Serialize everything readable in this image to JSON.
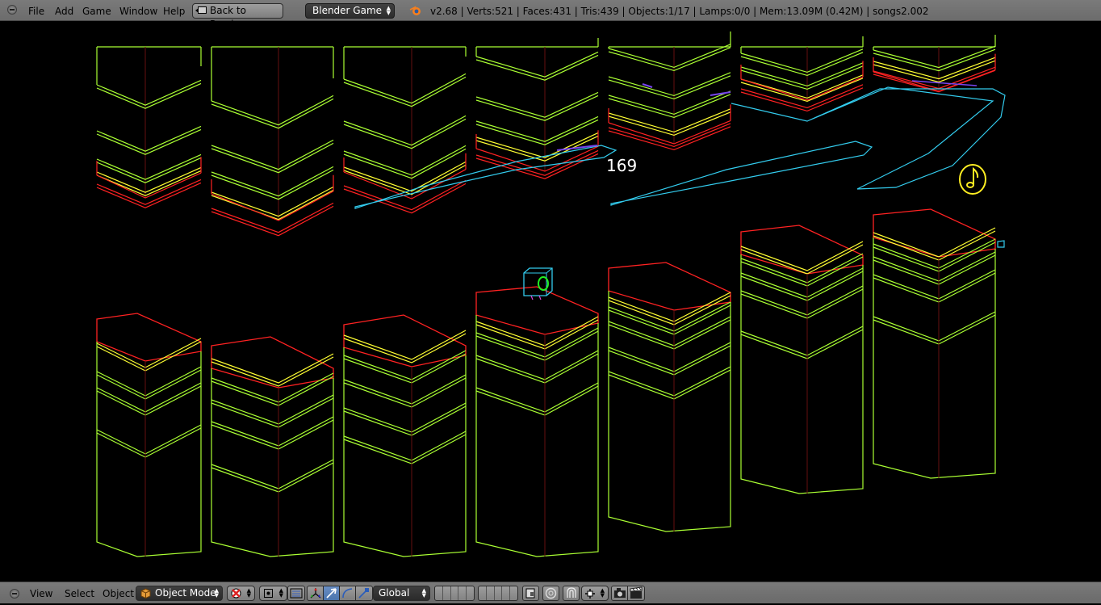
{
  "header": {
    "menus": [
      "File",
      "Add",
      "Game",
      "Window",
      "Help"
    ],
    "back_button": "Back to Previous",
    "engine": "Blender Game",
    "stats": "v2.68 | Verts:521 | Faces:431 | Tris:439 | Objects:1/17 | Lamps:0/0 | Mem:13.09M (0.42M) | songs2.002"
  },
  "viewport": {
    "score": "169",
    "icons": [
      "music-note-icon",
      "camera-cube-icon"
    ],
    "colors": {
      "green": "#aaff33",
      "yellow": "#ffff33",
      "red": "#ff2222",
      "cyan": "#33ccee",
      "background": "#000000"
    }
  },
  "footer": {
    "menus": [
      "View",
      "Select",
      "Object"
    ],
    "mode": "Object Mode",
    "orientation": "Global",
    "icons": [
      "cube-icon",
      "viewport-shading-icon",
      "pivot-icon",
      "manipulator-icon",
      "translate-icon",
      "rotate-icon",
      "scale-icon",
      "layers-icon",
      "lock-icon",
      "proportional-edit-icon",
      "snap-icon",
      "snap-target-icon",
      "render-icon",
      "animation-icon"
    ]
  }
}
